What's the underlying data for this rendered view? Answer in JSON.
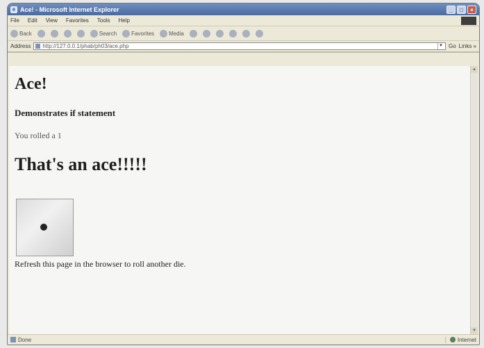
{
  "window": {
    "title": "Ace! - Microsoft Internet Explorer"
  },
  "menu": [
    "File",
    "Edit",
    "View",
    "Favorites",
    "Tools",
    "Help"
  ],
  "toolbar": {
    "back": "Back",
    "search": "Search",
    "favorites": "Favorites",
    "media": "Media"
  },
  "address": {
    "label": "Address",
    "url": "http://127.0.0.1/phab/ph03/ace.php",
    "go": "Go",
    "links": "Links »"
  },
  "page": {
    "heading": "Ace!",
    "subheading": "Demonstrates if statement",
    "roll_text": "You rolled a 1",
    "ace_text": "That's an ace!!!!!",
    "refresh_text": "Refresh this page in the browser to roll another die."
  },
  "status": {
    "left": "Done",
    "zone": "Internet"
  }
}
